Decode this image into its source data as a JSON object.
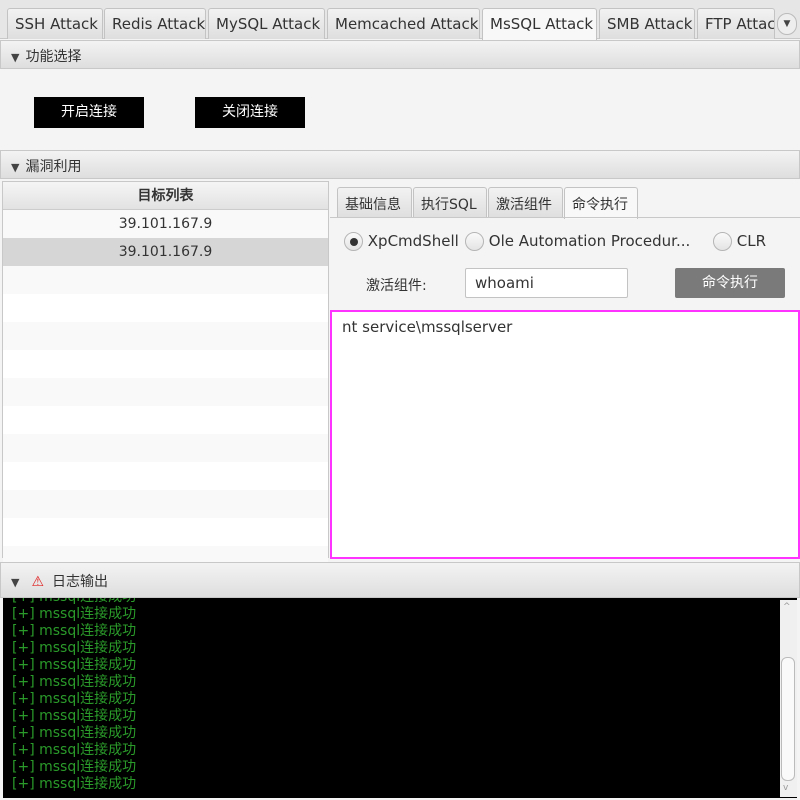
{
  "tabs": [
    "SSH Attack",
    "Redis Attack",
    "MySQL Attack",
    "Memcached Attack",
    "MsSQL Attack",
    "SMB Attack",
    "FTP Attac"
  ],
  "selected_tab": "MsSQL Attack",
  "section1": {
    "title": "功能选择",
    "open_btn": "开启连接",
    "close_btn": "关闭连接"
  },
  "section2": {
    "title": "漏洞利用"
  },
  "target_table": {
    "header": "目标列表",
    "rows": [
      "39.101.167.9",
      "39.101.167.9"
    ],
    "selected_row": 1
  },
  "subtabs": [
    "基础信息",
    "执行SQL",
    "激活组件",
    "命令执行"
  ],
  "selected_subtab": "命令执行",
  "radios": [
    {
      "label": "XpCmdShell",
      "checked": true
    },
    {
      "label": "Ole Automation Procedur...",
      "checked": false
    },
    {
      "label": "CLR",
      "checked": false
    }
  ],
  "cmd": {
    "label": "激活组件:",
    "value": "whoami",
    "button": "命令执行"
  },
  "output": "nt service\\mssqlserver",
  "log": {
    "title": "日志输出",
    "lines": [
      "[+] mssql连接成功",
      "[+] mssql连接成功",
      "[+] mssql连接成功",
      "[+] mssql连接成功",
      "[+] mssql连接成功",
      "[+] mssql连接成功",
      "[+] mssql连接成功",
      "[+] mssql连接成功",
      "[+] mssql连接成功",
      "[+] mssql连接成功",
      "[+] mssql连接成功",
      "[+] mssql连接成功"
    ]
  },
  "colors": {
    "log_text": "#2a9a2a",
    "output_border": "#ff33ff",
    "warning": "#e02020"
  }
}
